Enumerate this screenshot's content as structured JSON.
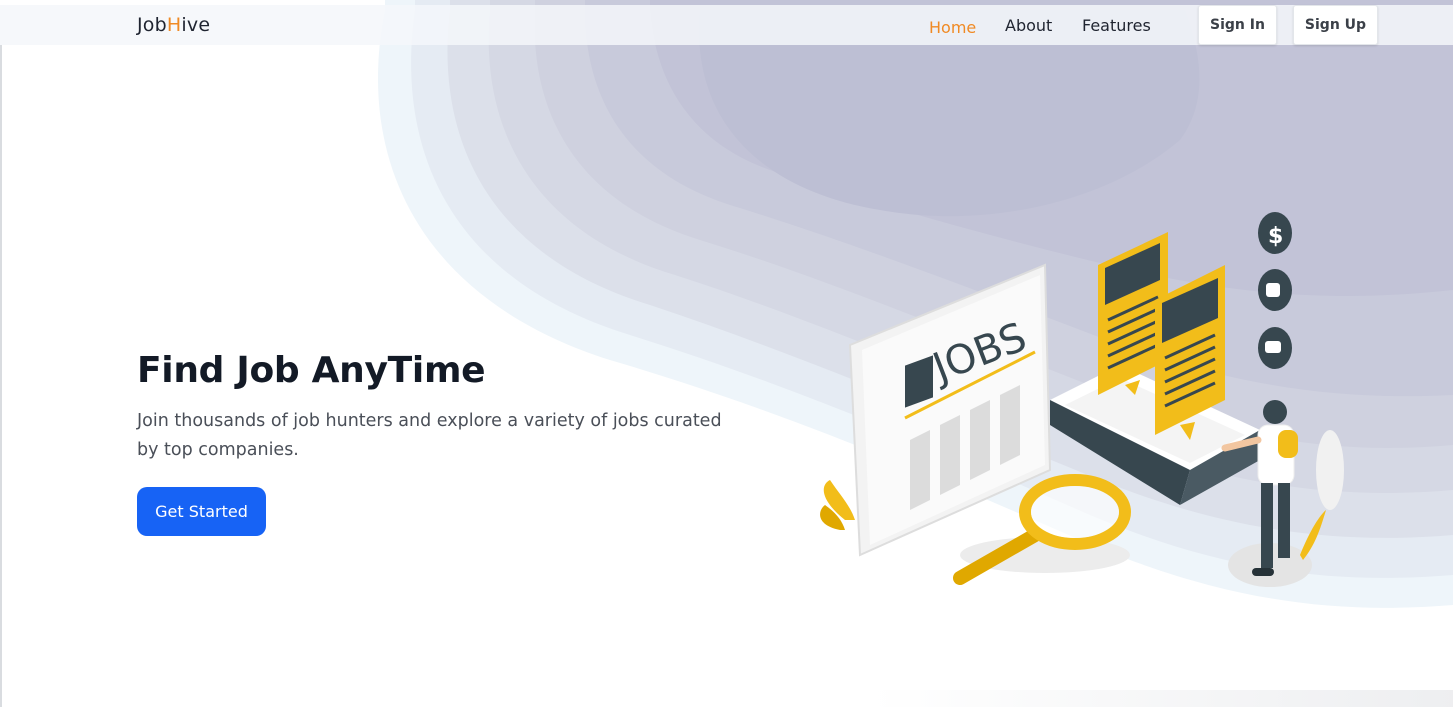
{
  "navbar": {
    "brand_part1": "Job",
    "brand_accent": "H",
    "brand_part2": "ive",
    "links": [
      {
        "label": "Home",
        "active": true
      },
      {
        "label": "About",
        "active": false
      },
      {
        "label": "Features",
        "active": false
      }
    ],
    "sign_in_label": "Sign In",
    "sign_up_label": "Sign Up"
  },
  "hero": {
    "title": "Find Job AnyTime",
    "subtitle": "Join thousands of job hunters and explore a variety of jobs curated by top companies.",
    "cta_label": "Get Started"
  },
  "illustration": {
    "newspaper_text": "JOBS",
    "icon_dollar": "$",
    "icons": [
      "dollar-coin-icon",
      "thumbs-up-icon",
      "chat-icon"
    ]
  },
  "colors": {
    "accent_orange": "#f08a24",
    "primary_blue": "#1763f5",
    "illustration_yellow": "#f2bd1a",
    "illustration_dark": "#37474f",
    "blob_lavender": "#c4c6d8"
  }
}
